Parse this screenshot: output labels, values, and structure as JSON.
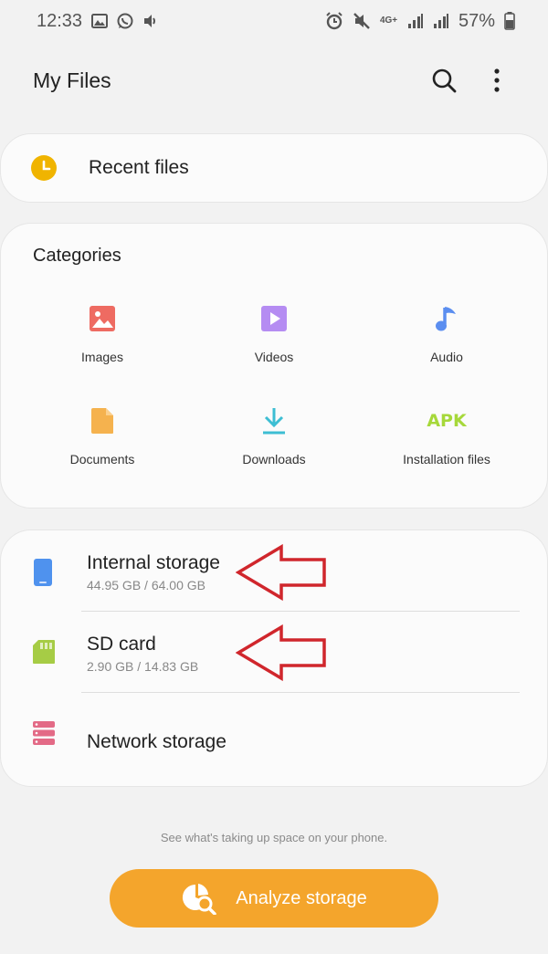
{
  "status_bar": {
    "time": "12:33",
    "network": "4G+",
    "battery": "57%"
  },
  "app_bar": {
    "title": "My Files",
    "search_icon": "search-icon",
    "more_icon": "more-vert-icon"
  },
  "recent": {
    "label": "Recent files",
    "icon": "clock-icon",
    "icon_color": "#F0B400"
  },
  "categories": {
    "heading": "Categories",
    "items": [
      {
        "label": "Images",
        "icon": "image-icon",
        "color": "#EE6B62"
      },
      {
        "label": "Videos",
        "icon": "video-icon",
        "color": "#B58CF2"
      },
      {
        "label": "Audio",
        "icon": "music-note-icon",
        "color": "#5B8EF0"
      },
      {
        "label": "Documents",
        "icon": "document-icon",
        "color": "#F5B24E"
      },
      {
        "label": "Downloads",
        "icon": "download-icon",
        "color": "#3DBED3"
      },
      {
        "label": "Installation files",
        "icon": "apk-icon",
        "icon_text": "APK",
        "color": "#A6D83A"
      }
    ]
  },
  "storage": {
    "items": [
      {
        "name": "Internal storage",
        "size": "44.95 GB / 64.00 GB",
        "icon": "phone-icon",
        "color": "#4F92EE"
      },
      {
        "name": "SD card",
        "size": "2.90 GB / 14.83 GB",
        "icon": "sd-card-icon",
        "color": "#A6CC45"
      },
      {
        "name": "Network storage",
        "icon": "server-icon",
        "color": "#E36A86"
      }
    ]
  },
  "footer": {
    "hint": "See what's taking up space on your phone.",
    "analyze_label": "Analyze storage",
    "analyze_color": "#F4A52C"
  },
  "annotations": {
    "arrow_color": "#D0262C"
  }
}
